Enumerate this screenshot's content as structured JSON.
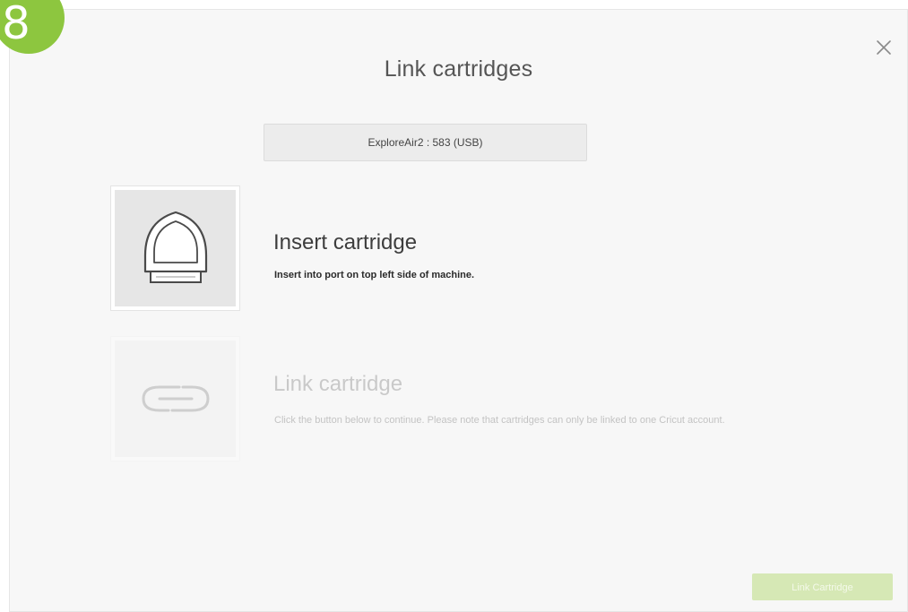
{
  "step_badge": {
    "number": "8",
    "color": "#8dc63f"
  },
  "dialog": {
    "title": "Link cartridges",
    "close_icon": "close-icon"
  },
  "machine_select": {
    "value": "ExploreAir2 : 583 (USB)"
  },
  "steps": [
    {
      "icon": "cartridge-icon",
      "heading": "Insert cartridge",
      "description": "Insert into port on top left side of machine.",
      "state": "active"
    },
    {
      "icon": "link-icon",
      "heading": "Link cartridge",
      "description": "Click the button below to continue. Please note that cartridges can only be linked to one Cricut account.",
      "state": "inactive"
    }
  ],
  "footer": {
    "link_button_label": "Link Cartridge",
    "link_button_state": "disabled",
    "accent_color": "#d6e8b5"
  }
}
